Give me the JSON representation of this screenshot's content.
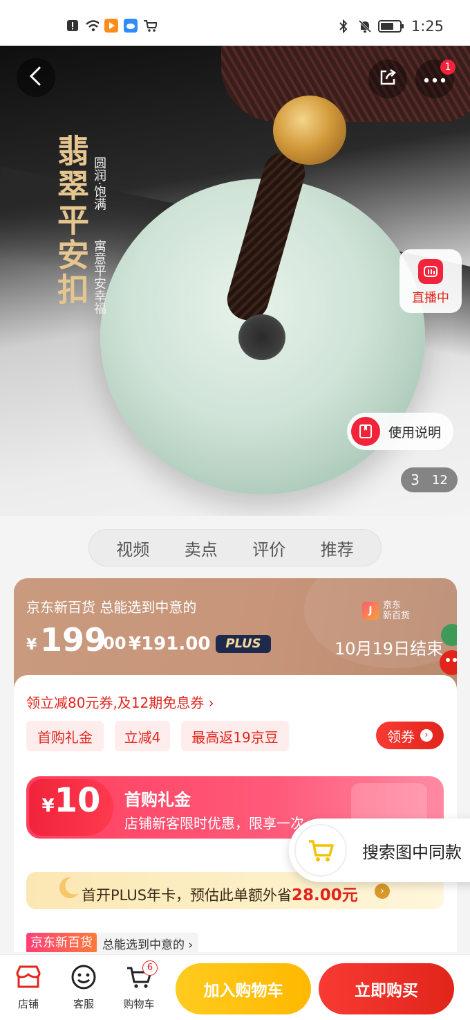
{
  "status_bar": {
    "time": "1:25"
  },
  "hero": {
    "title": "翡翠平安扣",
    "subtitle_1": "圆润·饱满",
    "subtitle_2": "寓意平安幸福",
    "live_label": "直播中",
    "guide_label": "使用说明",
    "pager_current": "3",
    "pager_total": "12",
    "more_badge": "1"
  },
  "tabs": [
    "视频",
    "卖点",
    "评价",
    "推荐"
  ],
  "price_card": {
    "slogan": "京东新百货 总能选到中意的",
    "brand_mark": "J",
    "brand_line1": "京东",
    "brand_line2": "新百货",
    "yen": "¥",
    "price_int": "199",
    "price_cents": ".00",
    "plus_price": "¥191.00",
    "plus_badge": "PLUS",
    "end_text": "10月19日结束"
  },
  "coupons": {
    "summary": "领立减80元券,及12期免息券 ›",
    "chips": [
      "首购礼金",
      "立减4",
      "最高返19京豆"
    ],
    "get_label": "领券",
    "get_arrow": "›"
  },
  "gift": {
    "yen": "¥",
    "amount": "10",
    "title": "首购礼金",
    "desc": "店铺新客限时优惠，限享一次"
  },
  "plus_banner": {
    "text": "首开PLUS年卡，预估此单额外省",
    "amount": "28.00元",
    "arrow": "›"
  },
  "store_tag": {
    "brand": "京东新百货",
    "slogan": "总能选到中意的 ›"
  },
  "search_same": {
    "label": "搜索图中同款"
  },
  "bottom_bar": {
    "store": "店铺",
    "service": "客服",
    "cart": "购物车",
    "cart_count": "6",
    "add_to_cart": "加入购物车",
    "buy_now": "立即购买"
  },
  "colors": {
    "brand_red": "#e1251b",
    "price_card_bg": "#c99a7e",
    "add_cart_yellow": "#ffb800",
    "jade_green": "#cfe3d7"
  }
}
